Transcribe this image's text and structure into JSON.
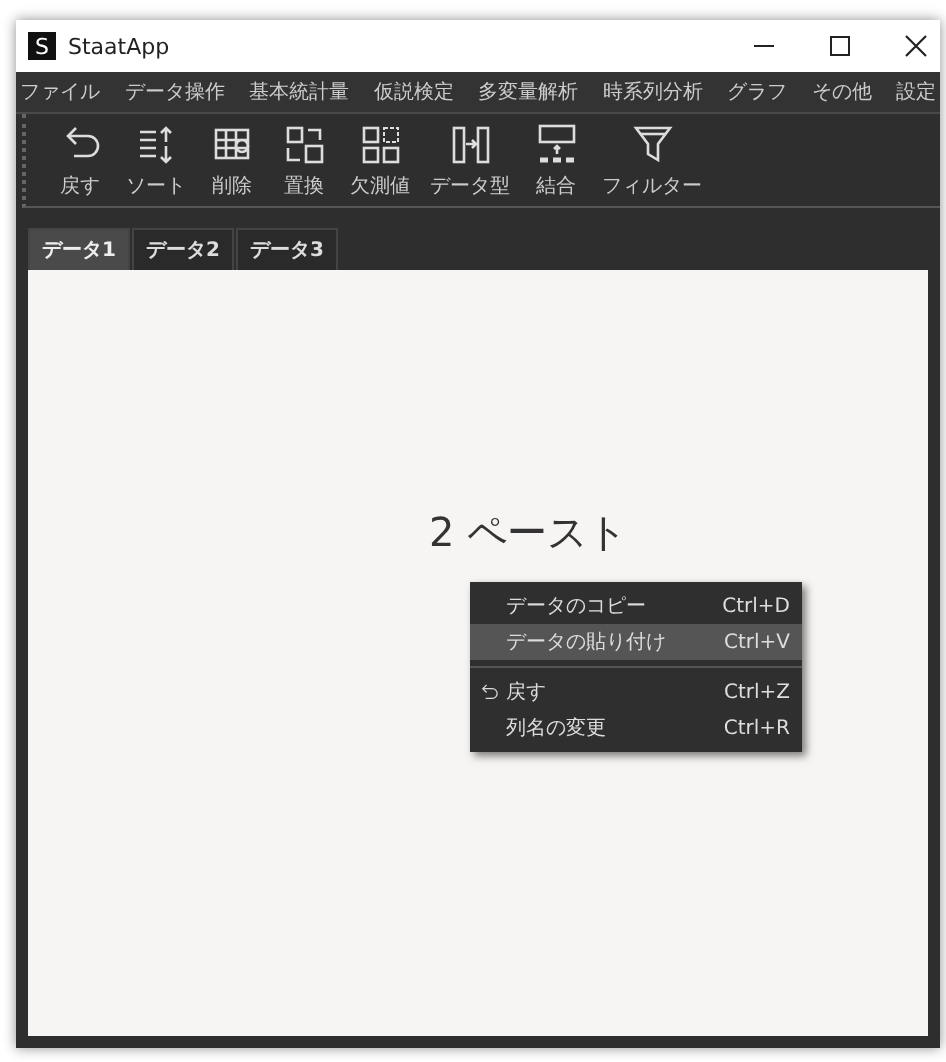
{
  "window": {
    "title": "StaatApp",
    "logo": "S"
  },
  "menu": [
    "ファイル",
    "データ操作",
    "基本統計量",
    "仮説検定",
    "多変量解析",
    "時系列分析",
    "グラフ",
    "その他",
    "設定"
  ],
  "toolbar": [
    {
      "kind": "undo",
      "label": "戻す"
    },
    {
      "kind": "sort",
      "label": "ソート"
    },
    {
      "kind": "delete",
      "label": "削除"
    },
    {
      "kind": "replace",
      "label": "置換"
    },
    {
      "kind": "missing",
      "label": "欠測値"
    },
    {
      "kind": "datatype",
      "label": "データ型"
    },
    {
      "kind": "merge",
      "label": "結合"
    },
    {
      "kind": "filter",
      "label": "フィルター"
    }
  ],
  "tabs": [
    {
      "label": "データ1",
      "selected": true
    },
    {
      "label": "データ2",
      "selected": false
    },
    {
      "label": "データ3",
      "selected": false
    }
  ],
  "content": {
    "caption": "2 ペースト"
  },
  "context_menu": [
    {
      "kind": "item",
      "label": "データのコピー",
      "shortcut": "Ctrl+D",
      "selected": false
    },
    {
      "kind": "item",
      "label": "データの貼り付け",
      "shortcut": "Ctrl+V",
      "selected": true
    },
    {
      "kind": "separator"
    },
    {
      "kind": "undo",
      "label": "戻す",
      "shortcut": "Ctrl+Z",
      "selected": false
    },
    {
      "kind": "item",
      "label": "列名の変更",
      "shortcut": "Ctrl+R",
      "selected": false
    }
  ]
}
